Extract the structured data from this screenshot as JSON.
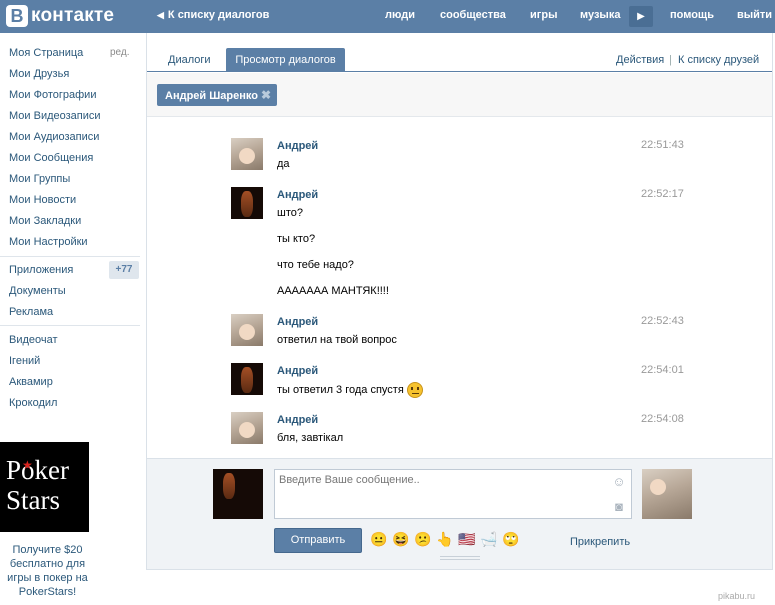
{
  "header": {
    "logo_letter": "В",
    "logo_text": "контакте",
    "back_link": "К списку диалогов",
    "nav": [
      "люди",
      "сообщества",
      "игры",
      "музыка",
      "помощь",
      "выйти"
    ]
  },
  "sidebar": {
    "items": [
      "Моя Страница",
      "Мои Друзья",
      "Мои Фотографии",
      "Мои Видеозаписи",
      "Мои Аудиозаписи",
      "Мои Сообщения",
      "Мои Группы",
      "Мои Новости",
      "Мои Закладки",
      "Мои Настройки"
    ],
    "edit_label": "ред.",
    "apps": [
      "Приложения",
      "Документы",
      "Реклама"
    ],
    "apps_badge": "+77",
    "extra": [
      "Видеочат",
      "Ігений",
      "Аквамир",
      "Крокодил"
    ]
  },
  "ad": {
    "logo_line1": "Poker",
    "logo_line2": "Stars",
    "text": "Получите $20 бесплатно для игры в покер на PokerStars!"
  },
  "tabs": {
    "dialogs": "Диалоги",
    "view": "Просмотр диалогов",
    "actions": "Действия",
    "separator": "|",
    "to_friends": "К списку друзей"
  },
  "filter": {
    "chip_label": "Андрей Шаренко",
    "chip_close": "✖"
  },
  "messages": [
    {
      "name": "Андрей",
      "time": "22:51:43",
      "lines": [
        "да"
      ],
      "avatar": "baby"
    },
    {
      "name": "Андрей",
      "time": "22:52:17",
      "lines": [
        "што?",
        "ты кто?",
        "что тебе надо?",
        "ААААААА МАНТЯК!!!!"
      ],
      "avatar": "rock"
    },
    {
      "name": "Андрей",
      "time": "22:52:43",
      "lines": [
        "ответил на твой вопрос"
      ],
      "avatar": "baby"
    },
    {
      "name": "Андрей",
      "time": "22:54:01",
      "lines": [
        "ты ответил 3 года спустя"
      ],
      "avatar": "rock"
    },
    {
      "name": "Андрей",
      "time": "22:54:08",
      "lines": [
        "бля, завтікал"
      ],
      "avatar": "baby"
    }
  ],
  "compose": {
    "placeholder": "Введите Ваше сообщение..",
    "send_label": "Отправить",
    "attach_label": "Прикрепить",
    "smiles": [
      "😐",
      "😆",
      "😕",
      "👆",
      "🇺🇸",
      "🛁",
      "🙄"
    ]
  },
  "watermark": "pikabu.ru",
  "colors": {
    "header_blue": "#5b7fa6",
    "link_blue": "#2b587a",
    "compose_bg": "#f0f3f6"
  }
}
